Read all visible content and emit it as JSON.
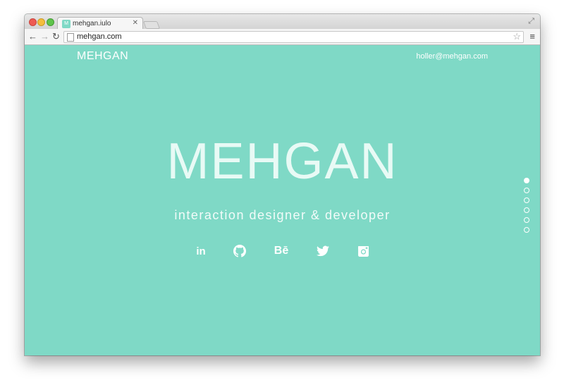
{
  "browser": {
    "tab_title": "mehgan.iulo",
    "favicon_text": "M",
    "url": "mehgan.com"
  },
  "site": {
    "logo": "MEHGAN",
    "email": "holler@mehgan.com",
    "hero_title": "MEHGAN",
    "hero_subtitle": "interaction designer & developer",
    "social": [
      {
        "name": "linkedin-icon",
        "glyph": "in"
      },
      {
        "name": "github-icon",
        "glyph": ""
      },
      {
        "name": "behance-icon",
        "glyph": "Bē"
      },
      {
        "name": "twitter-icon",
        "glyph": ""
      },
      {
        "name": "instagram-icon",
        "glyph": ""
      }
    ],
    "section_dots": 6,
    "active_dot": 0,
    "colors": {
      "background": "#7fd9c6",
      "text": "#ffffff"
    }
  }
}
